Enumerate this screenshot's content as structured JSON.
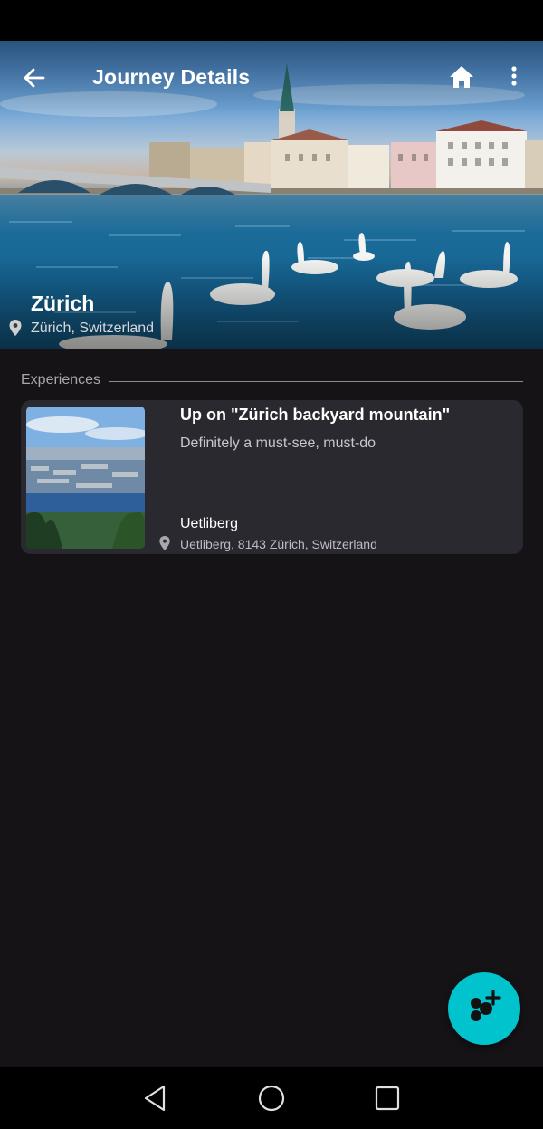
{
  "app_bar": {
    "title": "Journey Details",
    "back_icon": "arrow-back-icon",
    "home_icon": "home-icon",
    "more_icon": "more-vert-icon"
  },
  "hero": {
    "city": "Zürich",
    "location": "Zürich, Switzerland",
    "location_icon": "location-pin-icon"
  },
  "experiences": {
    "section_label": "Experiences",
    "items": [
      {
        "title": "Up on \"Zürich backyard mountain\"",
        "subtitle": "Definitely a must-see, must-do",
        "place": "Uetliberg",
        "address": "Uetliberg, 8143 Zürich, Switzerland",
        "pin_icon": "location-pin-icon"
      }
    ]
  },
  "fab": {
    "icon": "add-experience-icon"
  },
  "system_nav": {
    "back_icon": "nav-back-icon",
    "home_icon": "nav-home-icon",
    "recents_icon": "nav-recents-icon"
  },
  "colors": {
    "background": "#151316",
    "card": "#2b2930",
    "accent": "#00c3cd"
  }
}
